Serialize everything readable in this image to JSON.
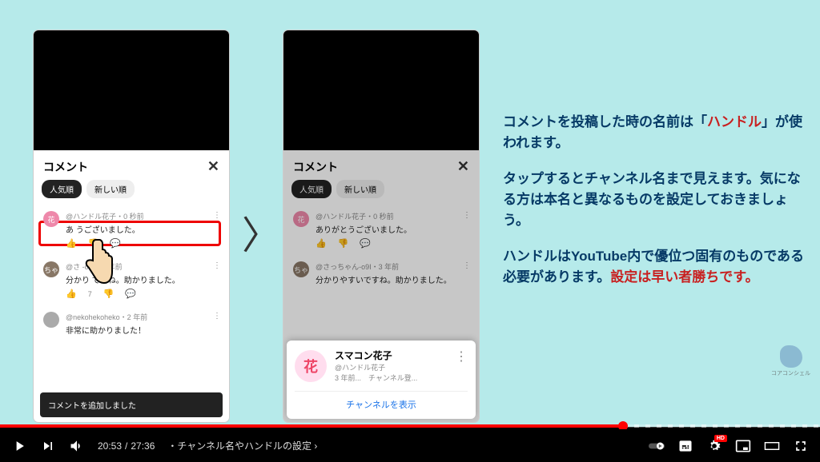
{
  "phones": {
    "comments_title": "コメント",
    "tabs": {
      "popular": "人気順",
      "newest": "新しい順"
    },
    "comment1": {
      "meta": "@ハンドル花子・0 秒前",
      "text": "ありがとうございました。"
    },
    "comment1b": {
      "text_partial": "あ         うございました。"
    },
    "comment2": {
      "meta_left": "@さ          -o9I・3 年前",
      "meta_right": "@さっちゃん-o9I・3 年前",
      "text_left": "分かり      ですね。助かりました。",
      "text_right": "分かりやすいですね。助かりました。",
      "likes": "7"
    },
    "comment3": {
      "meta": "@nekohekoheko・2 年前",
      "text": "非常に助かりました！"
    },
    "snackbar": "コメントを追加しました",
    "avatar_labels": {
      "hana": "花",
      "cha": "ちゃ"
    },
    "channel_popup": {
      "name": "スマコン花子",
      "handle": "@ハンドル花子",
      "sub": "3 年前...　チャンネル登...",
      "show": "チャンネルを表示"
    }
  },
  "explain": {
    "p1a": "コメントを投稿した時の名前は「",
    "p1b_red": "ハンドル",
    "p1c": "」が使われます。",
    "p2": "タップするとチャンネル名まで見えます。気になる方は本名と異なるものを設定しておきましょう。",
    "p3a": "ハンドルはYouTube内で優位つ固有のものである必要があります。",
    "p3b_red": "設定は早い者勝ちです。"
  },
  "watermark": "コアコンシェル",
  "player": {
    "current": "20:53",
    "duration": "27:36",
    "chapter": "・チャンネル名やハンドルの設定",
    "hd": "HD"
  }
}
